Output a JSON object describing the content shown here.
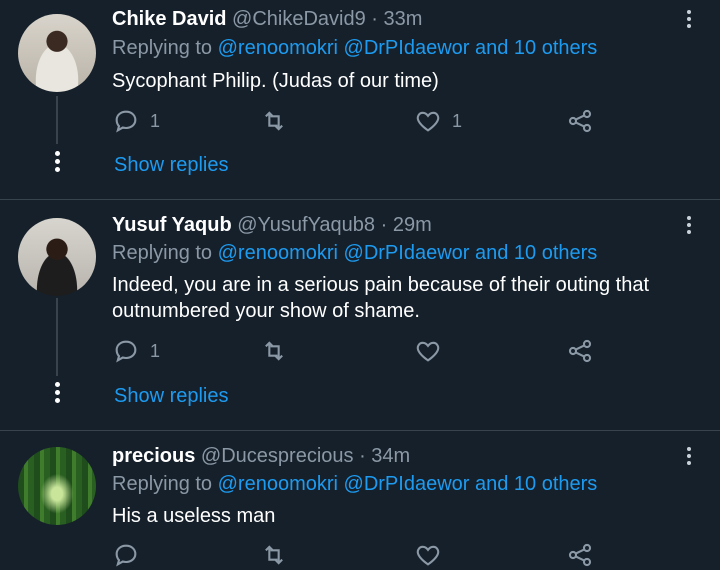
{
  "tweets": [
    {
      "name": "Chike David",
      "handle": "@ChikeDavid9",
      "sep": " · ",
      "time": "33m",
      "replying_prefix": "Replying to ",
      "mentions": "@renoomokri @DrPIdaewor and 10 others",
      "text": "Sycophant Philip. (Judas of our time)",
      "reply_count": "1",
      "retweet_count": "",
      "like_count": "1",
      "show_replies": "Show replies"
    },
    {
      "name": "Yusuf Yaqub",
      "handle": "@YusufYaqub8",
      "sep": " · ",
      "time": "29m",
      "replying_prefix": "Replying to ",
      "mentions": "@renoomokri @DrPIdaewor and 10 others",
      "text": "Indeed, you are in a serious pain because of their outing that outnumbered your show of shame.",
      "reply_count": "1",
      "retweet_count": "",
      "like_count": "",
      "show_replies": "Show replies"
    },
    {
      "name": "precious",
      "handle": "@Ducesprecious",
      "sep": " · ",
      "time": "34m",
      "replying_prefix": "Replying to ",
      "mentions": "@renoomokri @DrPIdaewor and 10 others",
      "text": "His a useless man",
      "reply_count": "",
      "retweet_count": "",
      "like_count": ""
    }
  ],
  "icons": {
    "reply": "reply-icon",
    "retweet": "retweet-icon",
    "like": "heart-icon",
    "share": "share-icon",
    "more": "more-vertical-icon"
  },
  "colors": {
    "background": "#15202b",
    "accent": "#1d9bf0",
    "muted": "#8b98a5",
    "divider": "#38444d"
  }
}
